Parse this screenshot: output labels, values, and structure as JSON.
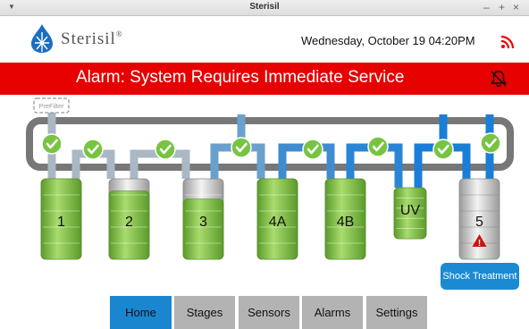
{
  "window": {
    "title": "Sterisil",
    "min": "–",
    "max": "+",
    "close": "×",
    "menu": "▼"
  },
  "header": {
    "brand": "Sterisil",
    "trademark": "®",
    "datetime": "Wednesday, October 19 04:20PM"
  },
  "alarm": {
    "message": "Alarm: System Requires Immediate Service"
  },
  "prefilter": {
    "label": "PreFilter"
  },
  "stages": [
    {
      "label": "1",
      "status": "ok",
      "color": "green",
      "level": 1.0
    },
    {
      "label": "2",
      "status": "ok",
      "color": "green",
      "level": 0.85
    },
    {
      "label": "3",
      "status": "ok",
      "color": "green",
      "level": 0.75
    },
    {
      "label": "4A",
      "status": "ok",
      "color": "green",
      "level": 1.0
    },
    {
      "label": "4B",
      "status": "ok",
      "color": "green",
      "level": 1.0
    },
    {
      "label": "UV",
      "status": "ok",
      "color": "green",
      "level": 1.0
    },
    {
      "label": "5",
      "status": "warning",
      "color": "gray",
      "level": 1.0
    }
  ],
  "actions": {
    "shock_treatment": "Shock Treatment"
  },
  "nav": {
    "tabs": [
      "Home",
      "Stages",
      "Sensors",
      "Alarms",
      "Settings"
    ],
    "active": "Home"
  },
  "colors": {
    "alarm": "#e60000",
    "accent": "#1a86d0",
    "ok": "#78c442",
    "warning": "#d01010"
  }
}
